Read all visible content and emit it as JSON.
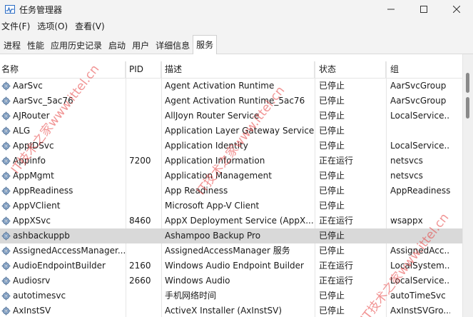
{
  "window": {
    "title": "任务管理器",
    "controls": {
      "minimize": "minimize",
      "maximize": "maximize",
      "close": "close"
    }
  },
  "menu": [
    "文件(F)",
    "选项(O)",
    "查看(V)"
  ],
  "tabs": [
    {
      "label": "进程",
      "active": false
    },
    {
      "label": "性能",
      "active": false
    },
    {
      "label": "应用历史记录",
      "active": false
    },
    {
      "label": "启动",
      "active": false
    },
    {
      "label": "用户",
      "active": false
    },
    {
      "label": "详细信息",
      "active": false
    },
    {
      "label": "服务",
      "active": true
    }
  ],
  "table": {
    "columns": {
      "name": "名称",
      "pid": "PID",
      "description": "描述",
      "status": "状态",
      "group": "组"
    },
    "rows": [
      {
        "name": "AarSvc",
        "pid": "",
        "description": "Agent Activation Runtime",
        "status": "已停止",
        "group": "AarSvcGroup"
      },
      {
        "name": "AarSvc_5ac76",
        "pid": "",
        "description": "Agent Activation Runtime_5ac76",
        "status": "已停止",
        "group": "AarSvcGroup"
      },
      {
        "name": "AJRouter",
        "pid": "",
        "description": "AllJoyn Router Service",
        "status": "已停止",
        "group": "LocalService..."
      },
      {
        "name": "ALG",
        "pid": "",
        "description": "Application Layer Gateway Service",
        "status": "已停止",
        "group": ""
      },
      {
        "name": "AppIDSvc",
        "pid": "",
        "description": "Application Identity",
        "status": "已停止",
        "group": "LocalService..."
      },
      {
        "name": "Appinfo",
        "pid": "7200",
        "description": "Application Information",
        "status": "正在运行",
        "group": "netsvcs"
      },
      {
        "name": "AppMgmt",
        "pid": "",
        "description": "Application Management",
        "status": "已停止",
        "group": "netsvcs"
      },
      {
        "name": "AppReadiness",
        "pid": "",
        "description": "App Readiness",
        "status": "已停止",
        "group": "AppReadiness"
      },
      {
        "name": "AppVClient",
        "pid": "",
        "description": "Microsoft App-V Client",
        "status": "已停止",
        "group": ""
      },
      {
        "name": "AppXSvc",
        "pid": "8460",
        "description": "AppX Deployment Service (AppX...",
        "status": "正在运行",
        "group": "wsappx"
      },
      {
        "name": "ashbackuppb",
        "pid": "",
        "description": "Ashampoo Backup Pro",
        "status": "已停止",
        "group": "",
        "selected": true
      },
      {
        "name": "AssignedAccessManager...",
        "pid": "",
        "description": "AssignedAccessManager 服务",
        "status": "已停止",
        "group": "AssignedAcc..."
      },
      {
        "name": "AudioEndpointBuilder",
        "pid": "2160",
        "description": "Windows Audio Endpoint Builder",
        "status": "正在运行",
        "group": "LocalSystem..."
      },
      {
        "name": "Audiosrv",
        "pid": "2660",
        "description": "Windows Audio",
        "status": "正在运行",
        "group": "LocalService..."
      },
      {
        "name": "autotimesvc",
        "pid": "",
        "description": "手机网络时间",
        "status": "已停止",
        "group": "autoTimeSvc"
      },
      {
        "name": "AxInstSV",
        "pid": "",
        "description": "ActiveX Installer (AxInstSV)",
        "status": "已停止",
        "group": "AxInstSVGro..."
      }
    ]
  },
  "watermark": {
    "text": "IT技术之家www.ittel.cn",
    "color": "#e63c3c"
  }
}
